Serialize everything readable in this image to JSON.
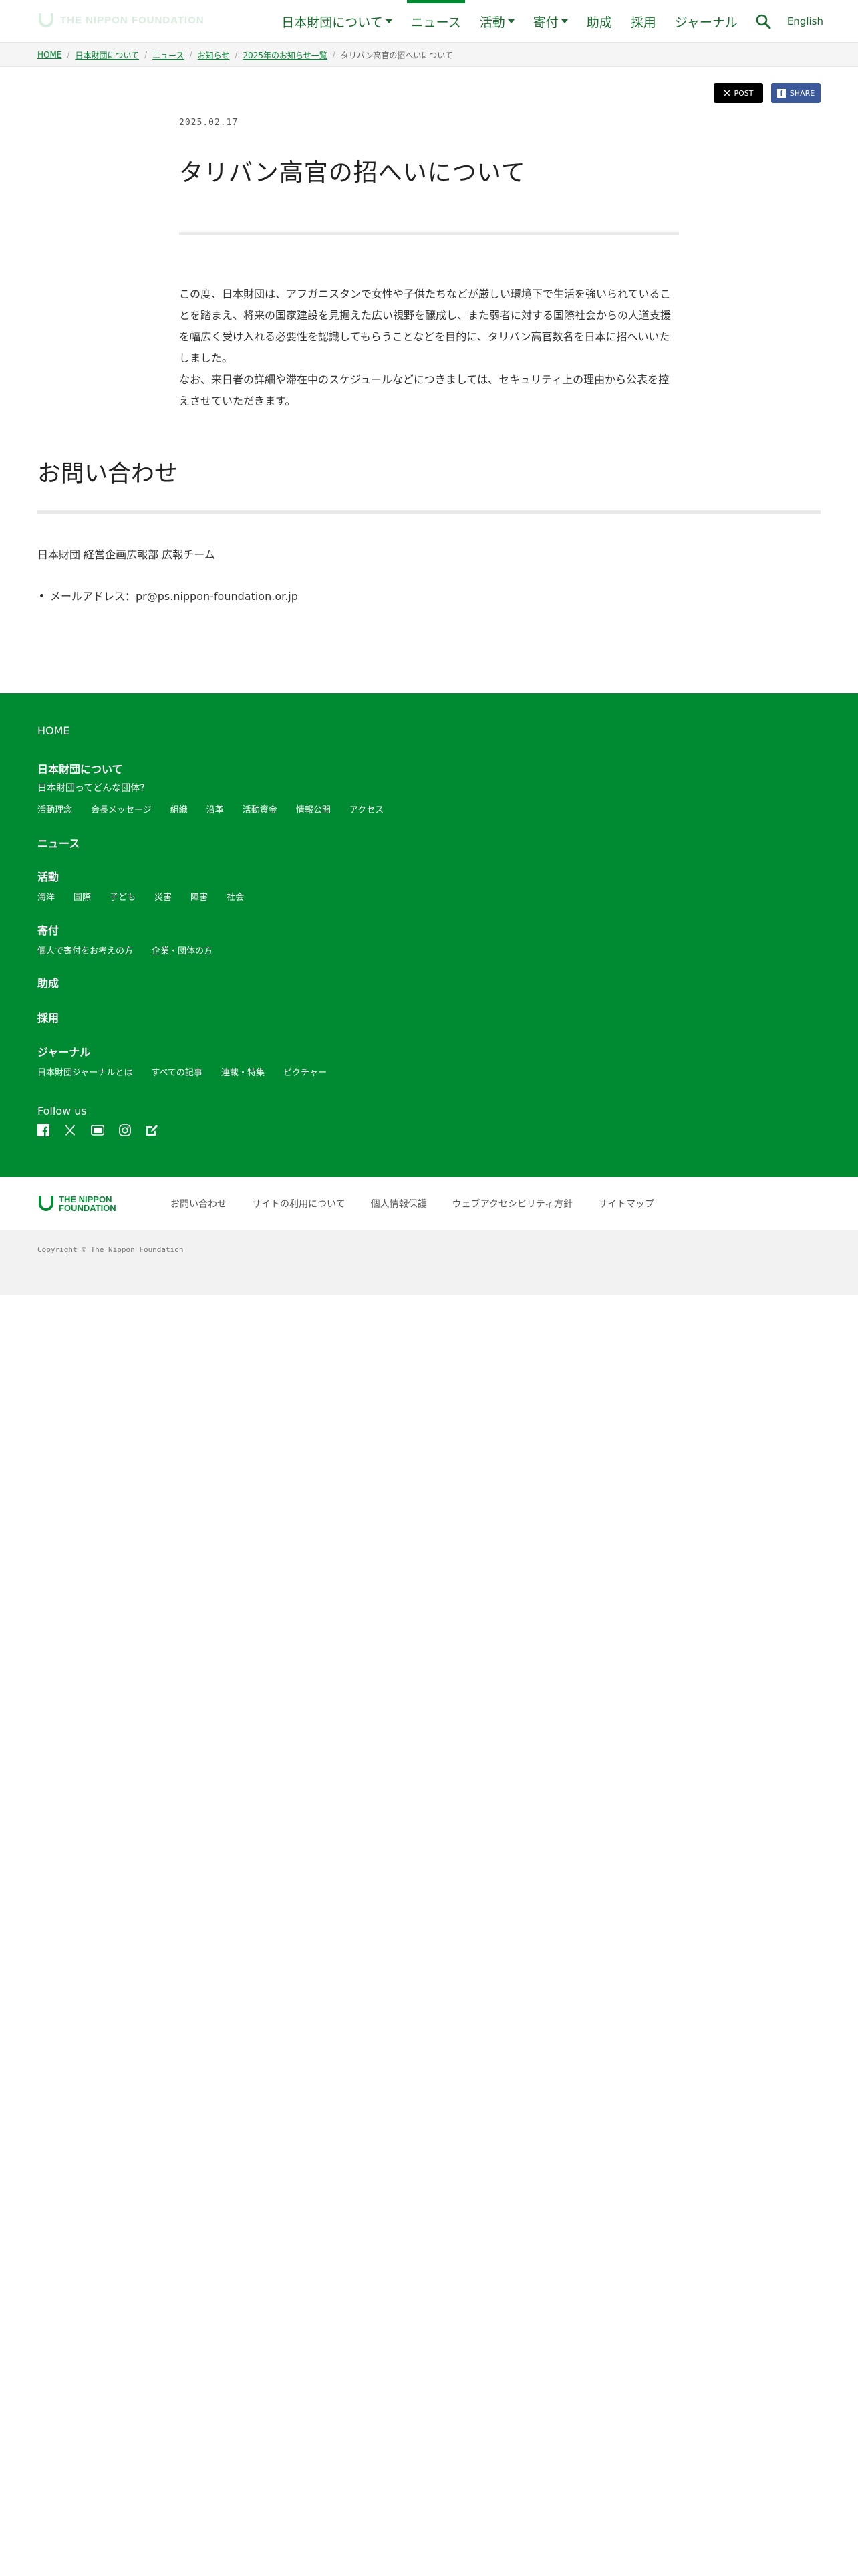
{
  "header": {
    "logo_text": "THE NIPPON FOUNDATION",
    "nav": [
      {
        "label": "日本財団について",
        "dropdown": true
      },
      {
        "label": "ニュース",
        "active": true
      },
      {
        "label": "活動",
        "dropdown": true
      },
      {
        "label": "寄付",
        "dropdown": true
      },
      {
        "label": "助成"
      },
      {
        "label": "採用"
      },
      {
        "label": "ジャーナル"
      }
    ],
    "search_icon": "search-icon",
    "language": "English"
  },
  "breadcrumb": {
    "items": [
      "HOME",
      "日本財団について",
      "ニュース",
      "お知らせ",
      "2025年のお知らせ一覧"
    ],
    "current": "タリバン高官の招へいについて"
  },
  "share": {
    "post_label": "POST",
    "share_label": "SHARE"
  },
  "article": {
    "date": "2025.02.17",
    "title": "タリバン高官の招へいについて",
    "paragraph1": "この度、日本財団は、アフガニスタンで女性や子供たちなどが厳しい環境下で生活を強いられていることを踏まえ、将来の国家建設を見据えた広い視野を醸成し、また弱者に対する国際社会からの人道支援を幅広く受け入れる必要性を認識してもらうことなどを目的に、タリバン高官数名を日本に招へいいたしました。",
    "paragraph2": "なお、来日者の詳細や滞在中のスケジュールなどにつきましては、セキュリティ上の理由から公表を控えさせていただきます。"
  },
  "contact": {
    "heading": "お問い合わせ",
    "team": "日本財団 経営企画広報部 広報チーム",
    "email": "メールアドレス：pr@ps.nippon-foundation.or.jp"
  },
  "footer": {
    "home": "HOME",
    "about": {
      "heading": "日本財団について",
      "sub": "日本財団ってどんな団体?",
      "links": [
        "活動理念",
        "会長メッセージ",
        "組織",
        "沿革",
        "活動資金",
        "情報公開",
        "アクセス"
      ]
    },
    "news": "ニュース",
    "activities": {
      "heading": "活動",
      "links": [
        "海洋",
        "国際",
        "子ども",
        "災害",
        "障害",
        "社会"
      ]
    },
    "donate": {
      "heading": "寄付",
      "links": [
        "個人で寄付をお考えの方",
        "企業・団体の方"
      ]
    },
    "grants": "助成",
    "recruit": "採用",
    "journal": {
      "heading": "ジャーナル",
      "links": [
        "日本財団ジャーナルとは",
        "すべての記事",
        "連載・特集",
        "ピクチャー"
      ]
    },
    "follow_us": "Follow us",
    "social_icons": [
      "facebook-icon",
      "x-icon",
      "youtube-icon",
      "instagram-icon",
      "note-icon"
    ]
  },
  "bottom_bar": {
    "logo_line1": "THE NIPPON",
    "logo_line2": "FOUNDATION",
    "links": [
      "お問い合わせ",
      "サイトの利用について",
      "個人情報保護",
      "ウェブアクセシビリティ方針",
      "サイトマップ"
    ]
  },
  "copyright": "Copyright © The Nippon Foundation",
  "colors": {
    "brand_green": "#008a32",
    "facebook_blue": "#3b5998",
    "divider_gray": "#e9e9e9"
  }
}
